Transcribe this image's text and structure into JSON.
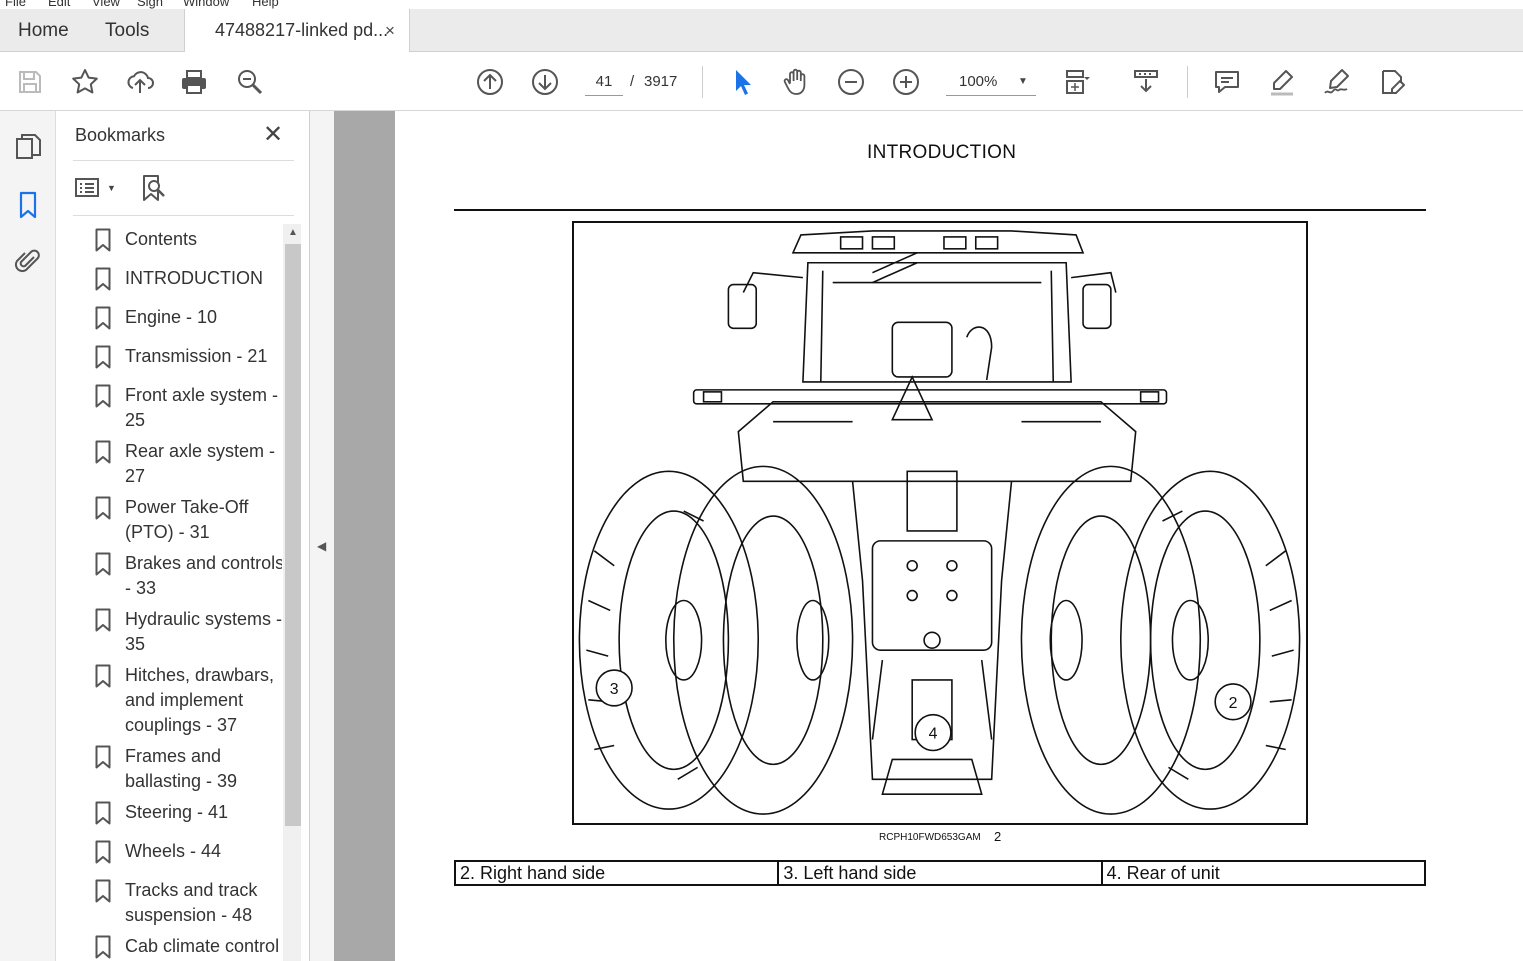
{
  "menubar": [
    "File",
    "Edit",
    "View",
    "Sign",
    "Window",
    "Help"
  ],
  "tabs": {
    "home": "Home",
    "tools": "Tools",
    "document": "47488217-linked pd...",
    "close": "×"
  },
  "toolbar": {
    "current_page": "41",
    "page_separator": "/",
    "total_pages": "3917",
    "zoom": "100%",
    "icons": [
      "save-icon",
      "star-icon",
      "upload-icon",
      "print-icon",
      "search-zoom-icon",
      "page-up-icon",
      "page-down-icon",
      "select-cursor-icon",
      "hand-icon",
      "zoom-out-icon",
      "zoom-in-icon",
      "fit-page-icon",
      "scroll-mode-icon",
      "comment-icon",
      "highlight-icon",
      "sign-icon",
      "edit-pdf-icon"
    ]
  },
  "bookmarks": {
    "title": "Bookmarks",
    "close": "✕",
    "items": [
      {
        "label": "Contents"
      },
      {
        "label": "INTRODUCTION"
      },
      {
        "label": "Engine - 10"
      },
      {
        "label": "Transmission - 21"
      },
      {
        "label": "Front axle system - 25"
      },
      {
        "label": "Rear axle system - 27"
      },
      {
        "label": "Power Take-Off (PTO) - 31"
      },
      {
        "label": "Brakes and controls - 33"
      },
      {
        "label": "Hydraulic systems - 35"
      },
      {
        "label": "Hitches, drawbars, and implement couplings - 37"
      },
      {
        "label": "Frames and ballasting - 39"
      },
      {
        "label": "Steering - 41"
      },
      {
        "label": "Wheels - 44"
      },
      {
        "label": "Tracks and track suspension - 48"
      },
      {
        "label": "Cab climate control"
      }
    ]
  },
  "page": {
    "title": "INTRODUCTION",
    "figure_caption": "RCPH10FWD653GAM",
    "figure_number": "2",
    "callouts": {
      "right": "2",
      "left": "3",
      "rear": "4"
    },
    "legend": [
      "2.  Right hand side",
      "3.  Left hand side",
      "4.  Rear of unit"
    ]
  }
}
